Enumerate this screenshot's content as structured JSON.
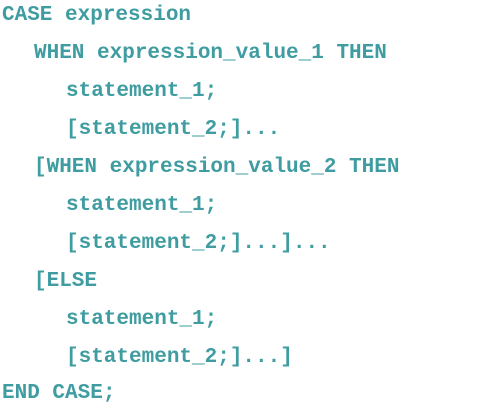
{
  "code": {
    "lines": [
      "CASE expression",
      "WHEN expression_value_1 THEN",
      "statement_1;",
      "[statement_2;]...",
      "[WHEN expression_value_2 THEN",
      "statement_1;",
      "[statement_2;]...]...",
      "[ELSE",
      "statement_1;",
      "[statement_2;]...]",
      "END CASE;"
    ],
    "text_color": "#3f9ca1",
    "background_color": "#ffffff"
  }
}
